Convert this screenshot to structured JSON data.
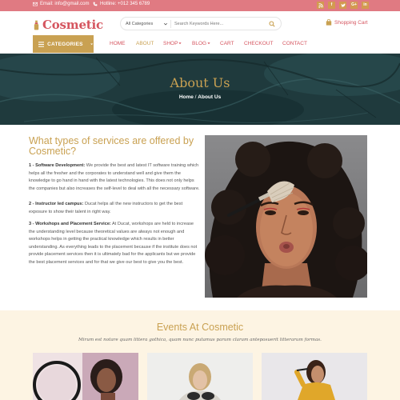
{
  "topbar": {
    "email": "Email: info@gmail.com",
    "hotline": "Hotline: +012 345 6789",
    "social_icons": [
      "rss-icon",
      "facebook-icon",
      "twitter-icon",
      "google-plus-icon",
      "linkedin-icon"
    ]
  },
  "header": {
    "logo_text": "Cosmetic",
    "search_category": "All Categories",
    "search_placeholder": "Search Keywords Here...",
    "cart_label": "Shopping Cart"
  },
  "nav": {
    "categories_label": "CATEGORIES",
    "items": [
      {
        "label": "HOME"
      },
      {
        "label": "ABOUT"
      },
      {
        "label": "SHOP"
      },
      {
        "label": "BLOG"
      },
      {
        "label": "CART"
      },
      {
        "label": "CHECKOUT"
      },
      {
        "label": "CONTACT"
      }
    ],
    "active": "ABOUT"
  },
  "hero": {
    "title": "About Us",
    "crumb_home": "Home",
    "crumb_sep": " / ",
    "crumb_current": "About Us"
  },
  "services": {
    "title": "What types of services are offered by Cosmetic?",
    "items": [
      {
        "heading": "1 - Software Development:",
        "text": " We provide the best and latest IT software training which helps all the fresher and the corporates to understand well and give them the knowledge to go hand in hand with the latest technologies. This does not only helps the companies but also increases the self-level to deal with all the necessary software."
      },
      {
        "heading": "2 - Instructor led campus:",
        "text": " Ducat helps all the new instructors to get the best exposure to show their talent in right way."
      },
      {
        "heading": "3 - Workshops and Placement Service:",
        "text": " At Ducat, workshops are held to increase the understanding level because theoretical values are always not enough and workshops helps in getting the practical knowledge which results in better understanding. As everything leads to the placement because if the institute does not provide placement services then it is ultimately bad for the applicants but we provide the best placement services and for that we give our best to give you the best."
      }
    ]
  },
  "events": {
    "title": "Events At Cosmetic",
    "subtitle": "Mirum est notare quam littera gothica, quam nunc putamus parum claram anteposuerit litterarum formas."
  },
  "colors": {
    "brand_pink": "#e07a82",
    "logo_red": "#d5555f",
    "gold": "#c9a152",
    "hero_bg": "#1f3a3d",
    "events_bg": "#fdf4e3"
  }
}
